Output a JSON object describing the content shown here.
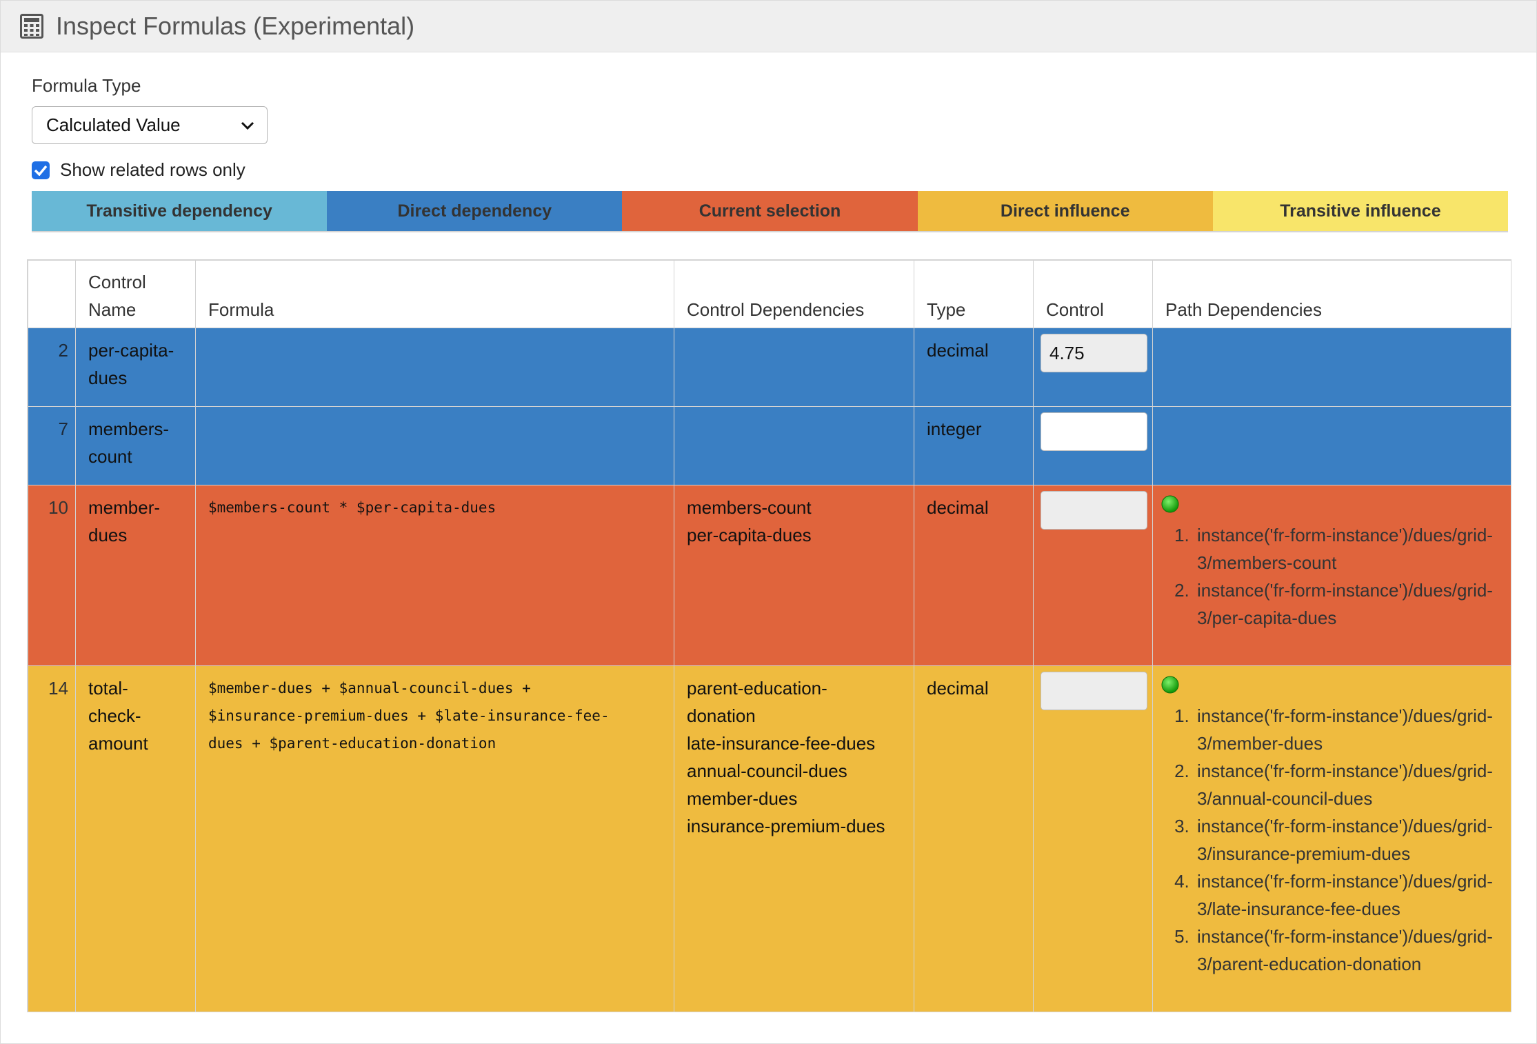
{
  "header": {
    "title": "Inspect Formulas (Experimental)",
    "icon": "calculator-icon"
  },
  "form": {
    "label": "Formula Type",
    "selected": "Calculated Value",
    "checkbox_label": "Show related rows only",
    "checkbox_checked": true
  },
  "legend": [
    {
      "label": "Transitive dependency",
      "color": "#68b8d6"
    },
    {
      "label": "Direct dependency",
      "color": "#3a7fc3"
    },
    {
      "label": "Current selection",
      "color": "#e0643c"
    },
    {
      "label": "Direct influence",
      "color": "#efbb3f"
    },
    {
      "label": "Transitive influence",
      "color": "#f8e56a"
    }
  ],
  "table": {
    "headers": [
      "",
      "Control Name",
      "Formula",
      "Control Dependencies",
      "Type",
      "Control",
      "Path Dependencies"
    ],
    "rows": [
      {
        "num": "2",
        "name_lines": [
          "per-capita-",
          "dues"
        ],
        "formula_lines": [],
        "dependencies": [],
        "type": "decimal",
        "control_value": "4.75",
        "paths": []
      },
      {
        "num": "7",
        "name_lines": [
          "members-",
          "count"
        ],
        "formula_lines": [],
        "dependencies": [],
        "type": "integer",
        "control_value": "",
        "paths": []
      },
      {
        "num": "10",
        "name_lines": [
          "member-",
          "dues"
        ],
        "formula_lines": [
          "$members-count * $per-capita-dues"
        ],
        "dependencies": [
          "members-count",
          "per-capita-dues"
        ],
        "type": "decimal",
        "control_value": "",
        "paths": [
          [
            "instance('fr-form-instance')/dues/grid-",
            "3/members-count"
          ],
          [
            "instance('fr-form-instance')/dues/grid-",
            "3/per-capita-dues"
          ]
        ]
      },
      {
        "num": "14",
        "name_lines": [
          "total-",
          "check-",
          "amount"
        ],
        "formula_lines": [
          "$member-dues + $annual-council-dues +",
          "$insurance-premium-dues + $late-insurance-fee-",
          "dues + $parent-education-donation"
        ],
        "dependencies": [
          "parent-education-",
          "donation",
          "late-insurance-fee-dues",
          "annual-council-dues",
          "member-dues",
          "insurance-premium-dues"
        ],
        "type": "decimal",
        "control_value": "",
        "paths": [
          [
            "instance('fr-form-instance')/dues/grid-",
            "3/member-dues"
          ],
          [
            "instance('fr-form-instance')/dues/grid-",
            "3/annual-council-dues"
          ],
          [
            "instance('fr-form-instance')/dues/grid-",
            "3/insurance-premium-dues"
          ],
          [
            "instance('fr-form-instance')/dues/grid-",
            "3/late-insurance-fee-dues"
          ],
          [
            "instance('fr-form-instance')/dues/grid-",
            "3/parent-education-donation"
          ]
        ]
      }
    ]
  }
}
